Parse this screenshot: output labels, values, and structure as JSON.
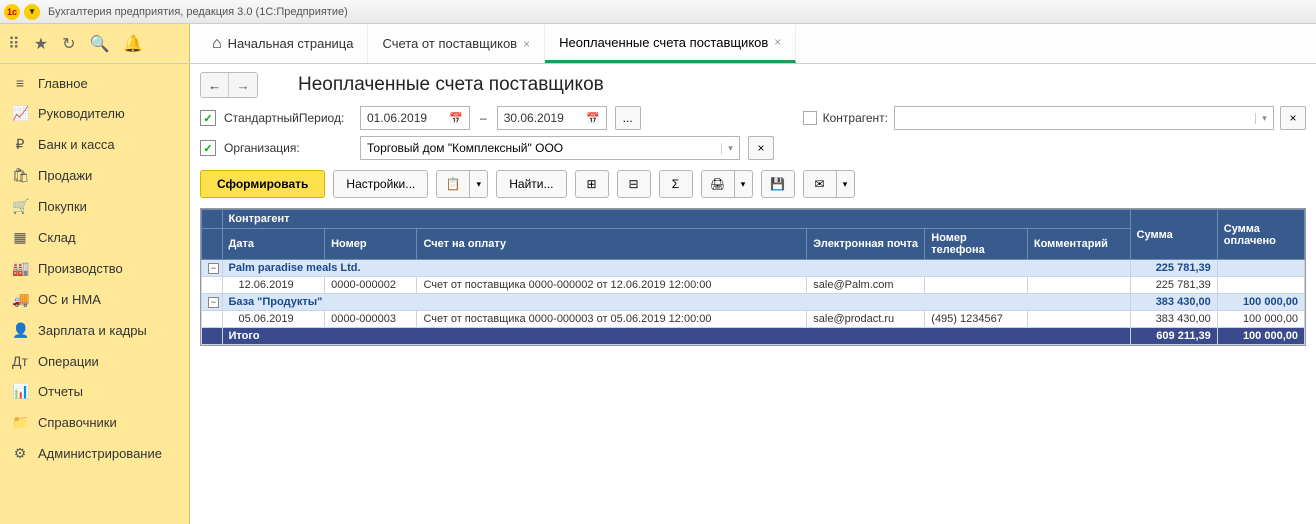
{
  "window": {
    "title": "Бухгалтерия предприятия, редакция 3.0  (1С:Предприятие)"
  },
  "tabs": {
    "home": "Начальная страница",
    "t1": "Счета от поставщиков",
    "t2": "Неоплаченные счета поставщиков"
  },
  "sidebar": [
    {
      "icon": "≡",
      "label": "Главное"
    },
    {
      "icon": "📈",
      "label": "Руководителю"
    },
    {
      "icon": "₽",
      "label": "Банк и касса"
    },
    {
      "icon": "🛍",
      "label": "Продажи"
    },
    {
      "icon": "🛒",
      "label": "Покупки"
    },
    {
      "icon": "▦",
      "label": "Склад"
    },
    {
      "icon": "🏭",
      "label": "Производство"
    },
    {
      "icon": "🚚",
      "label": "ОС и НМА"
    },
    {
      "icon": "👤",
      "label": "Зарплата и кадры"
    },
    {
      "icon": "Дт",
      "label": "Операции"
    },
    {
      "icon": "📊",
      "label": "Отчеты"
    },
    {
      "icon": "📁",
      "label": "Справочники"
    },
    {
      "icon": "⚙",
      "label": "Администрирование"
    }
  ],
  "page": {
    "title": "Неоплаченные счета поставщиков"
  },
  "filters": {
    "period_label": "СтандартныйПериод:",
    "date_from": "01.06.2019",
    "date_to": "30.06.2019",
    "org_label": "Организация:",
    "org_value": "Торговый дом \"Комплексный\" ООО",
    "contr_label": "Контрагент:",
    "ellipsis": "..."
  },
  "actions": {
    "form": "Сформировать",
    "settings": "Настройки...",
    "find": "Найти..."
  },
  "headers": {
    "contractor": "Контрагент",
    "date": "Дата",
    "number": "Номер",
    "invoice": "Счет на оплату",
    "email": "Электронная почта",
    "phone": "Номер телефона",
    "comment": "Комментарий",
    "sum": "Сумма",
    "paid": "Сумма оплачено"
  },
  "groups": [
    {
      "name": "Palm paradise meals Ltd.",
      "sum": "225 781,39",
      "paid": "",
      "rows": [
        {
          "date": "12.06.2019",
          "number": "0000-000002",
          "invoice": "Счет от поставщика 0000-000002 от 12.06.2019 12:00:00",
          "email": "sale@Palm.com",
          "phone": "",
          "comment": "",
          "sum": "225 781,39",
          "paid": ""
        }
      ]
    },
    {
      "name": "База \"Продукты\"",
      "sum": "383 430,00",
      "paid": "100 000,00",
      "rows": [
        {
          "date": "05.06.2019",
          "number": "0000-000003",
          "invoice": "Счет от поставщика 0000-000003 от 05.06.2019 12:00:00",
          "email": "sale@prodact.ru",
          "phone": "(495) 1234567",
          "comment": "",
          "sum": "383 430,00",
          "paid": "100 000,00"
        }
      ]
    }
  ],
  "totals": {
    "label": "Итого",
    "sum": "609 211,39",
    "paid": "100 000,00"
  }
}
